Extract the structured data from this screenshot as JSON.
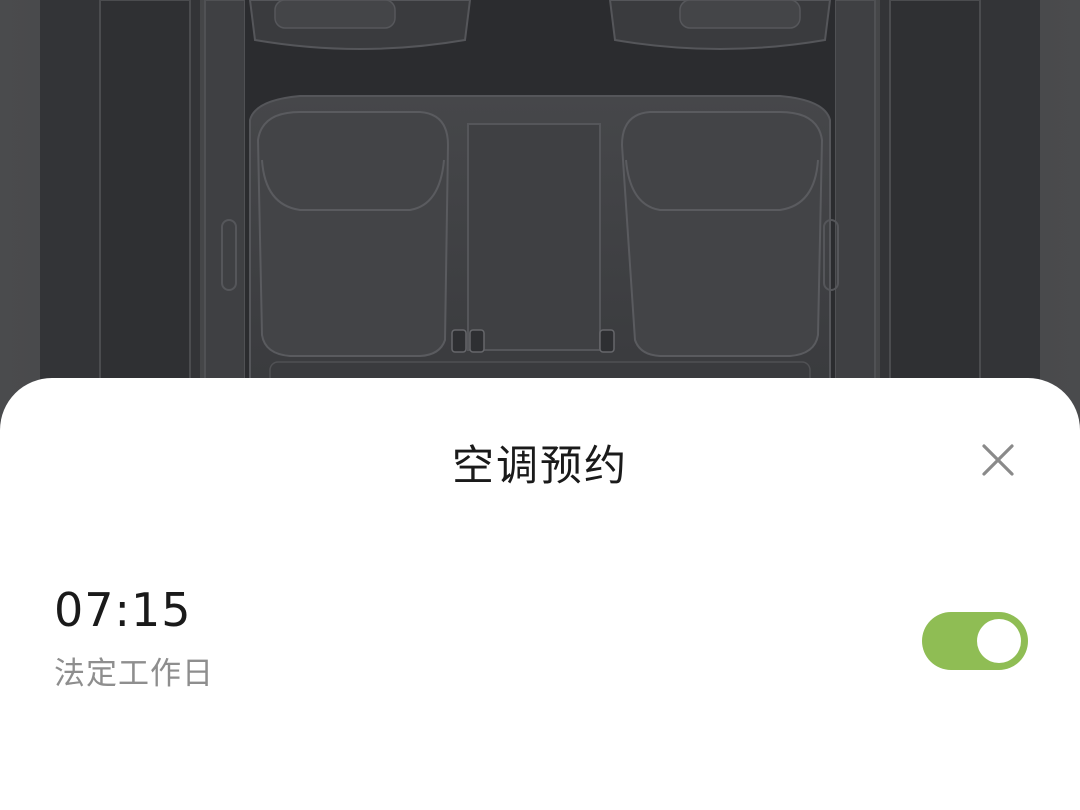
{
  "backdrop": {
    "image": "car-interior-rear-seats-topdown"
  },
  "sheet": {
    "title": "空调预约",
    "close_icon": "close-icon"
  },
  "schedule": {
    "time": "07:15",
    "repeat": "法定工作日",
    "enabled": true
  },
  "colors": {
    "toggle_on": "#8fbd54",
    "sheet_bg": "#ffffff",
    "title_text": "#1a1a1a",
    "secondary_text": "#8e8e8e",
    "icon": "#8a8a8a"
  }
}
